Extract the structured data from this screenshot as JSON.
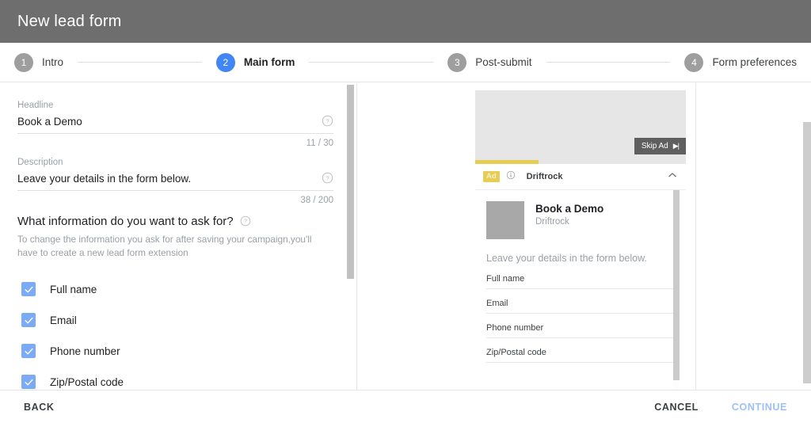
{
  "window": {
    "title": "New lead form"
  },
  "stepper": {
    "steps": [
      {
        "number": "1",
        "label": "Intro",
        "active": false
      },
      {
        "number": "2",
        "label": "Main form",
        "active": true
      },
      {
        "number": "3",
        "label": "Post-submit",
        "active": false
      },
      {
        "number": "4",
        "label": "Form preferences",
        "active": false
      }
    ],
    "active_color": "#4285f4",
    "inactive_color": "#9e9e9e"
  },
  "form": {
    "headline": {
      "label": "Headline",
      "value": "Book a Demo",
      "counter": "11 / 30",
      "help_icon": "help-circle-icon"
    },
    "description": {
      "label": "Description",
      "value": "Leave your details in the form below.",
      "counter": "38 / 200",
      "help_icon": "help-circle-icon"
    },
    "section": {
      "title": "What information do you want to ask for?",
      "help_icon": "help-circle-icon",
      "note": "To change the information you ask for after saving your campaign,you'll have to create a new lead form extension"
    },
    "fields": [
      {
        "label": "Full name",
        "checked": true
      },
      {
        "label": "Email",
        "checked": true
      },
      {
        "label": "Phone number",
        "checked": true
      },
      {
        "label": "Zip/Postal code",
        "checked": true
      }
    ],
    "checkbox_color": "#7baaf7"
  },
  "preview": {
    "video": {
      "skip_label": "Skip Ad",
      "skip_glyph": "skip-next-icon",
      "progress_percent": 30,
      "progress_color": "#e8cd55"
    },
    "ad_row": {
      "badge": "Ad",
      "info_icon": "info-circle-icon",
      "advertiser": "Driftrock",
      "collapse_icon": "chevron-up-icon"
    },
    "card": {
      "logo": "logo-placeholder",
      "title": "Book a Demo",
      "subtitle": "Driftrock",
      "description": "Leave your details in the form below.",
      "fields": [
        "Full name",
        "Email",
        "Phone number",
        "Zip/Postal code"
      ]
    }
  },
  "footer": {
    "back": "BACK",
    "cancel": "CANCEL",
    "continue": "CONTINUE",
    "continue_color": "#9ec0f8"
  }
}
